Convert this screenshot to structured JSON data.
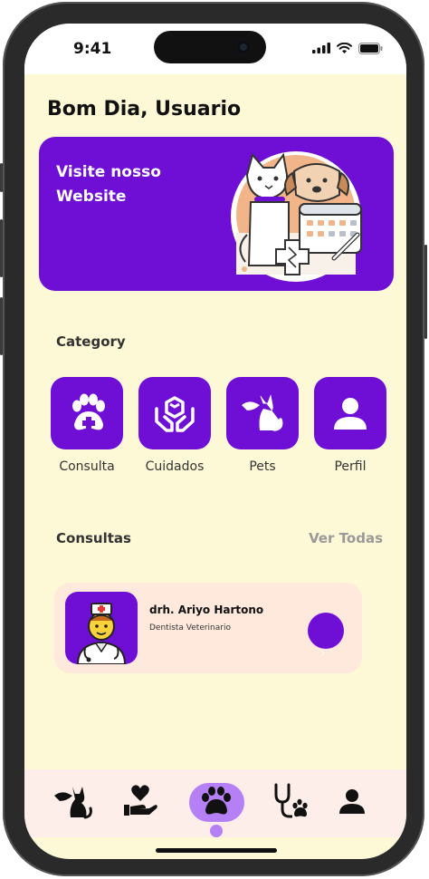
{
  "status_bar": {
    "time": "9:41"
  },
  "greeting": "Bom Dia, Usuario",
  "banner": {
    "text": "Visite nosso Website"
  },
  "category": {
    "title": "Category",
    "items": [
      {
        "label": "Consulta",
        "icon": "paw-medical-icon"
      },
      {
        "label": "Cuidados",
        "icon": "care-hands-icon"
      },
      {
        "label": "Pets",
        "icon": "pet-cat-hand-icon"
      },
      {
        "label": "Perfil",
        "icon": "user-icon"
      }
    ]
  },
  "consultas": {
    "title": "Consultas",
    "see_all": "Ver Todas",
    "card": {
      "name": "drh. Ariyo Hartono",
      "role": "Dentista Veterinario",
      "action": "›"
    }
  },
  "bottom_nav": {
    "items": [
      "pets-icon",
      "care-icon",
      "paw-icon",
      "stethoscope-icon",
      "user-icon"
    ],
    "active_index": 2
  },
  "colors": {
    "primary": "#6f0fd6",
    "background": "#fdf8d6",
    "card": "#ffe9dd",
    "nav_bg": "#feeeea",
    "nav_active": "#b57ff5"
  }
}
